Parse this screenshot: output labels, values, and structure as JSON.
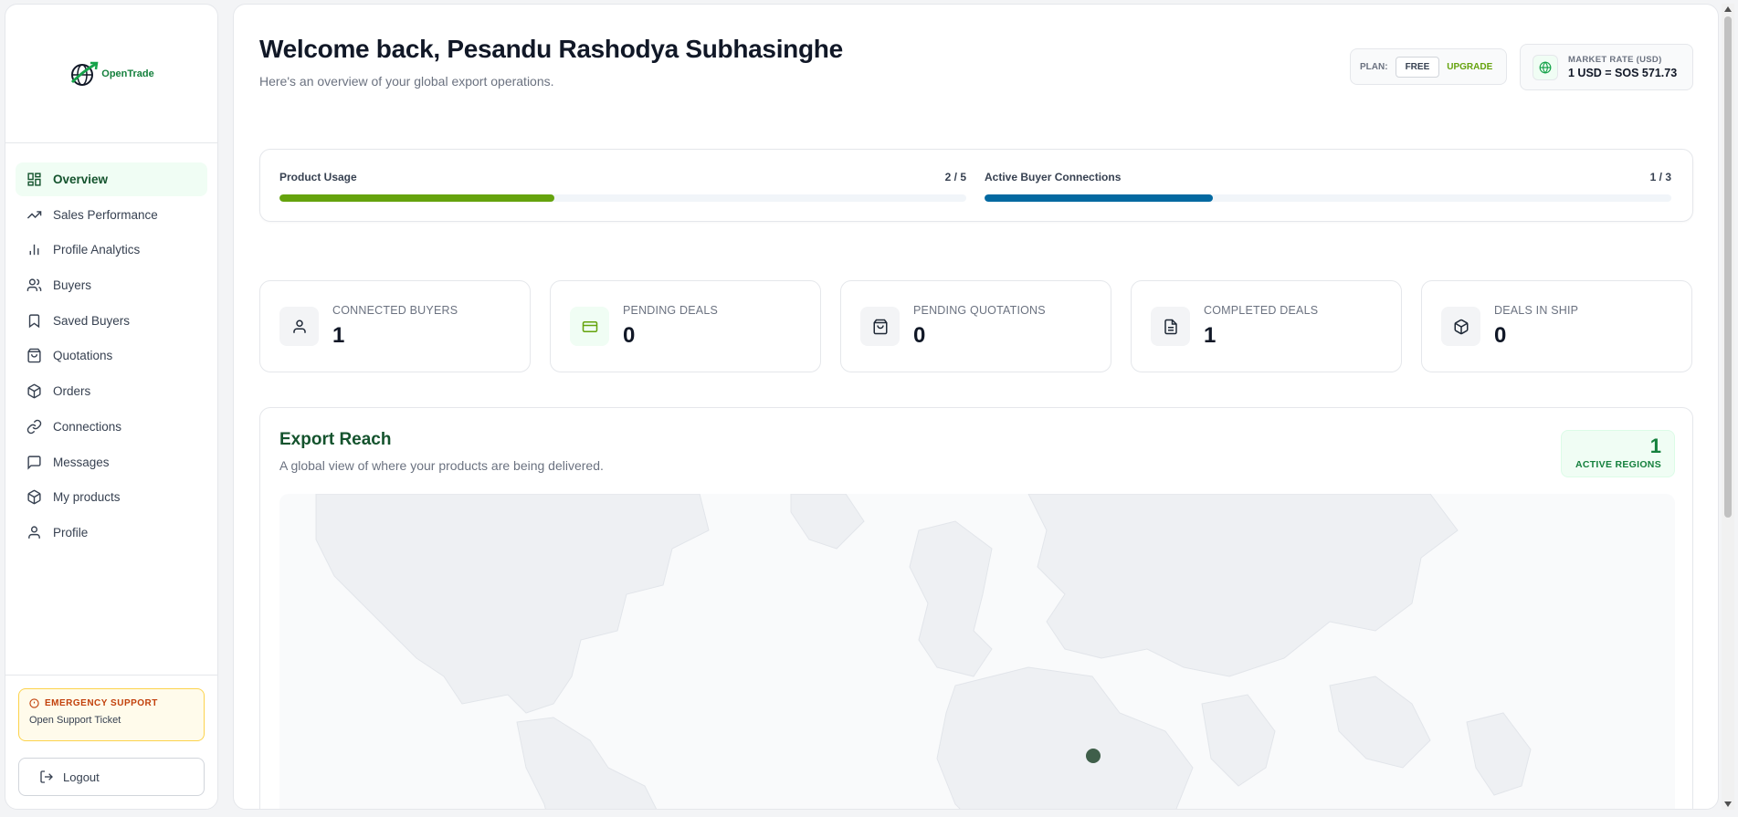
{
  "brand": {
    "name": "OpenTrade"
  },
  "sidebar": {
    "items": [
      {
        "label": "Overview",
        "icon": "grid-icon",
        "active": true
      },
      {
        "label": "Sales Performance",
        "icon": "trending-up-icon"
      },
      {
        "label": "Profile Analytics",
        "icon": "bar-chart-icon"
      },
      {
        "label": "Buyers",
        "icon": "users-icon"
      },
      {
        "label": "Saved Buyers",
        "icon": "bookmark-icon"
      },
      {
        "label": "Quotations",
        "icon": "shopping-bag-icon"
      },
      {
        "label": "Orders",
        "icon": "package-icon"
      },
      {
        "label": "Connections",
        "icon": "link-icon"
      },
      {
        "label": "Messages",
        "icon": "message-icon"
      },
      {
        "label": "My products",
        "icon": "box-icon"
      },
      {
        "label": "Profile",
        "icon": "user-icon"
      }
    ],
    "support": {
      "title": "EMERGENCY SUPPORT",
      "link": "Open Support Ticket"
    },
    "logout_label": "Logout"
  },
  "header": {
    "welcome": "Welcome back, Pesandu Rashodya Subhasinghe",
    "subtitle": "Here's an overview of your global export operations.",
    "plan": {
      "label": "PLAN:",
      "value": "FREE",
      "upgrade": "UPGRADE"
    },
    "rate": {
      "label": "MARKET RATE (USD)",
      "value": "1 USD = SOS 571.73"
    }
  },
  "usage": {
    "product": {
      "label": "Product Usage",
      "value": "2 / 5",
      "fraction": 0.4,
      "color": "#65a30d"
    },
    "buyers": {
      "label": "Active Buyer Connections",
      "value": "1 / 3",
      "fraction": 0.333,
      "color": "#0369a1"
    }
  },
  "stats": [
    {
      "label": "CONNECTED BUYERS",
      "value": "1",
      "icon": "user-icon"
    },
    {
      "label": "PENDING DEALS",
      "value": "0",
      "icon": "credit-card-icon"
    },
    {
      "label": "PENDING QUOTATIONS",
      "value": "0",
      "icon": "shopping-bag-icon"
    },
    {
      "label": "COMPLETED DEALS",
      "value": "1",
      "icon": "file-text-icon"
    },
    {
      "label": "DEALS IN SHIP",
      "value": "0",
      "icon": "package-icon"
    }
  ],
  "reach": {
    "title": "Export Reach",
    "subtitle": "A global view of where your products are being delivered.",
    "regions_count": "1",
    "regions_label": "ACTIVE REGIONS"
  },
  "colors": {
    "accent": "#65a30d",
    "brand": "#15803d",
    "blue": "#0369a1"
  }
}
